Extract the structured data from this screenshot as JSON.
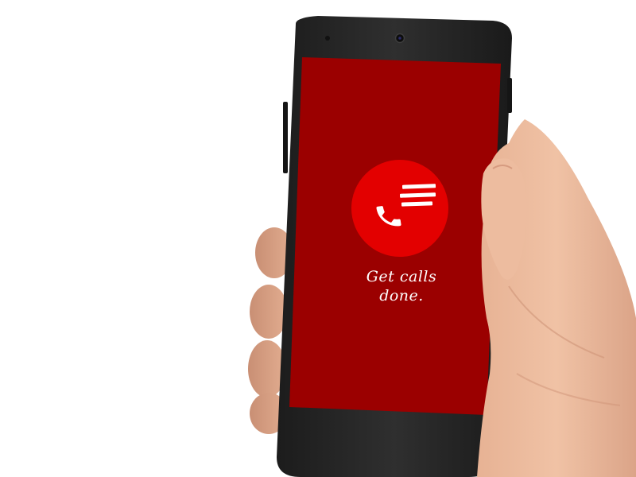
{
  "app": {
    "tagline": "Get calls\ndone."
  },
  "icons": {
    "app_icon": "phone-handset-with-speed-lines-icon"
  },
  "colors": {
    "screen_background": "#9b0000",
    "icon_circle": "#e30000",
    "icon_glyph": "#ffffff",
    "tagline_text": "#ffffff",
    "device_body": "#2b2b2b"
  }
}
